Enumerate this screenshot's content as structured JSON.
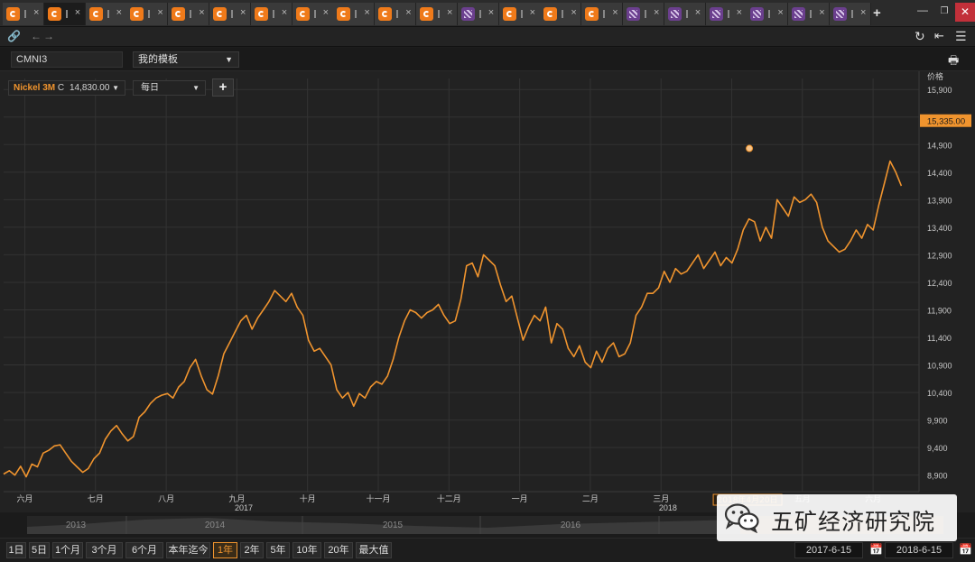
{
  "tabs": [
    {
      "icon": "orange-app-icon",
      "label": "c",
      "active": false
    },
    {
      "icon": "orange-app-icon",
      "label": "",
      "active": true
    },
    {
      "icon": "orange-app-icon",
      "label": "",
      "active": false
    },
    {
      "icon": "orange-app-icon",
      "label": "",
      "active": false
    },
    {
      "icon": "orange-app-icon",
      "label": "",
      "active": false
    },
    {
      "icon": "orange-app-icon",
      "label": "",
      "active": false
    },
    {
      "icon": "orange-app-icon",
      "label": "",
      "active": false
    },
    {
      "icon": "orange-app-icon",
      "label": "",
      "active": false
    },
    {
      "icon": "orange-app-icon",
      "label": "",
      "active": false
    },
    {
      "icon": "orange-app-icon",
      "label": "c",
      "active": false
    },
    {
      "icon": "orange-app-icon",
      "label": "",
      "active": false
    },
    {
      "icon": "purple-app-icon",
      "label": "",
      "active": false
    },
    {
      "icon": "orange-app-icon",
      "label": "",
      "active": false
    },
    {
      "icon": "orange-app-icon",
      "label": "",
      "active": false
    },
    {
      "icon": "orange-app-icon",
      "label": "",
      "active": false
    },
    {
      "icon": "purple-app-icon",
      "label": "",
      "active": false
    },
    {
      "icon": "purple-app-icon",
      "label": "",
      "active": false
    },
    {
      "icon": "purple-app-icon",
      "label": "",
      "active": false
    },
    {
      "icon": "purple-app-icon",
      "label": "",
      "active": false
    },
    {
      "icon": "purple-app-icon",
      "label": "",
      "active": false
    },
    {
      "icon": "purple-app-icon",
      "label": "",
      "active": false
    }
  ],
  "window": {
    "add_tab": "+",
    "minimize": "—",
    "maximize": "❐",
    "close": "✕"
  },
  "toolbar": {
    "ric": "CMNI3",
    "template": "我的模板",
    "series_name": "Nickel 3M",
    "series_price_type": "C",
    "series_value": "14,830.00",
    "interval": "每日",
    "add_label": "+"
  },
  "colors": {
    "line": "#f0942e",
    "grid": "#333333",
    "background": "#222222"
  },
  "chart_data": {
    "type": "line",
    "ylabel": "价格",
    "y_ticks": [
      8900,
      9400,
      9900,
      10400,
      10900,
      11400,
      11900,
      12400,
      12900,
      13400,
      13900,
      14400,
      14900,
      15400,
      15900
    ],
    "ylim": [
      8600,
      16100
    ],
    "last_value_label": "15,335.00",
    "last_value": 15335,
    "hover_label": "2018年4月20日",
    "hover_value": 14830,
    "x_labels": [
      "六月",
      "七月",
      "八月",
      "九月",
      "十月",
      "十一月",
      "十二月",
      "一月",
      "二月",
      "三月",
      "五月",
      "六月"
    ],
    "x_label_positions": [
      0.3,
      1.3,
      2.3,
      3.3,
      4.3,
      5.3,
      6.3,
      7.3,
      8.3,
      9.3,
      11.3,
      12.3
    ],
    "year_labels": [
      {
        "text": "2017",
        "at": 3.5
      },
      {
        "text": "2018",
        "at": 9.5
      }
    ],
    "x_range": [
      0,
      12.95
    ],
    "grid": true,
    "series": [
      {
        "points": [
          [
            0.0,
            8920
          ],
          [
            0.08,
            8980
          ],
          [
            0.15,
            8900
          ],
          [
            0.22,
            9060
          ],
          [
            0.3,
            8870
          ],
          [
            0.38,
            9100
          ],
          [
            0.46,
            9050
          ],
          [
            0.55,
            9300
          ],
          [
            0.63,
            9350
          ],
          [
            0.72,
            9430
          ],
          [
            0.8,
            9450
          ],
          [
            0.88,
            9300
          ],
          [
            0.96,
            9150
          ],
          [
            1.04,
            9050
          ],
          [
            1.12,
            8950
          ],
          [
            1.2,
            9020
          ],
          [
            1.28,
            9200
          ],
          [
            1.36,
            9300
          ],
          [
            1.44,
            9550
          ],
          [
            1.52,
            9700
          ],
          [
            1.6,
            9800
          ],
          [
            1.68,
            9650
          ],
          [
            1.76,
            9520
          ],
          [
            1.84,
            9600
          ],
          [
            1.92,
            9950
          ],
          [
            2.0,
            10050
          ],
          [
            2.1,
            10200
          ],
          [
            2.2,
            10300
          ],
          [
            2.3,
            10350
          ],
          [
            2.4,
            10380
          ],
          [
            2.5,
            10300
          ],
          [
            2.58,
            10500
          ],
          [
            2.66,
            10600
          ],
          [
            2.74,
            10850
          ],
          [
            2.82,
            11000
          ],
          [
            2.9,
            10700
          ],
          [
            2.97,
            10450
          ],
          [
            3.04,
            10370
          ],
          [
            3.12,
            10700
          ],
          [
            3.2,
            11100
          ],
          [
            3.28,
            11300
          ],
          [
            3.36,
            11500
          ],
          [
            3.44,
            11700
          ],
          [
            3.52,
            11800
          ],
          [
            3.6,
            11550
          ],
          [
            3.68,
            11750
          ],
          [
            3.76,
            11900
          ],
          [
            3.84,
            12050
          ],
          [
            3.92,
            12250
          ],
          [
            4.0,
            12150
          ],
          [
            4.08,
            12050
          ],
          [
            4.16,
            12200
          ],
          [
            4.24,
            11950
          ],
          [
            4.32,
            11800
          ],
          [
            4.4,
            11350
          ],
          [
            4.48,
            11150
          ],
          [
            4.56,
            11200
          ],
          [
            4.64,
            11050
          ],
          [
            4.72,
            10900
          ],
          [
            4.8,
            10450
          ],
          [
            4.88,
            10300
          ],
          [
            4.96,
            10400
          ],
          [
            5.03,
            10150
          ],
          [
            5.1,
            10380
          ],
          [
            5.18,
            10300
          ],
          [
            5.26,
            10500
          ],
          [
            5.34,
            10600
          ],
          [
            5.42,
            10550
          ],
          [
            5.5,
            10700
          ],
          [
            5.58,
            11000
          ],
          [
            5.66,
            11400
          ],
          [
            5.74,
            11700
          ],
          [
            5.82,
            11900
          ],
          [
            5.9,
            11850
          ],
          [
            5.98,
            11750
          ],
          [
            6.06,
            11850
          ],
          [
            6.14,
            11900
          ],
          [
            6.22,
            12000
          ],
          [
            6.3,
            11800
          ],
          [
            6.38,
            11650
          ],
          [
            6.46,
            11700
          ],
          [
            6.54,
            12100
          ],
          [
            6.62,
            12700
          ],
          [
            6.7,
            12750
          ],
          [
            6.78,
            12500
          ],
          [
            6.86,
            12900
          ],
          [
            6.94,
            12800
          ],
          [
            7.02,
            12700
          ],
          [
            7.1,
            12350
          ],
          [
            7.18,
            12050
          ],
          [
            7.26,
            12150
          ],
          [
            7.34,
            11750
          ],
          [
            7.42,
            11350
          ],
          [
            7.5,
            11600
          ],
          [
            7.58,
            11800
          ],
          [
            7.66,
            11700
          ],
          [
            7.74,
            11950
          ],
          [
            7.82,
            11300
          ],
          [
            7.9,
            11650
          ],
          [
            7.98,
            11550
          ],
          [
            8.06,
            11200
          ],
          [
            8.14,
            11050
          ],
          [
            8.22,
            11250
          ],
          [
            8.3,
            10950
          ],
          [
            8.38,
            10850
          ],
          [
            8.46,
            11150
          ],
          [
            8.54,
            10950
          ],
          [
            8.62,
            11200
          ],
          [
            8.7,
            11300
          ],
          [
            8.78,
            11050
          ],
          [
            8.86,
            11100
          ],
          [
            8.94,
            11300
          ],
          [
            9.02,
            11800
          ],
          [
            9.1,
            11950
          ],
          [
            9.18,
            12200
          ],
          [
            9.26,
            12200
          ],
          [
            9.34,
            12300
          ],
          [
            9.42,
            12600
          ],
          [
            9.5,
            12400
          ],
          [
            9.58,
            12650
          ],
          [
            9.66,
            12550
          ],
          [
            9.74,
            12600
          ],
          [
            9.82,
            12750
          ],
          [
            9.9,
            12900
          ],
          [
            9.98,
            12650
          ],
          [
            10.06,
            12800
          ]
        ]
      }
    ]
  },
  "navigator": {
    "years": [
      "2013",
      "2014",
      "2015",
      "2016"
    ]
  },
  "range_buttons": [
    "1日",
    "5日",
    "1个月",
    "3个月",
    "6个月",
    "本年迄今",
    "1年",
    "2年",
    "5年",
    "10年",
    "20年",
    "最大值"
  ],
  "active_range": "1年",
  "dates": {
    "from": "2017-6-15",
    "to": "2018-6-15"
  },
  "watermark": "五矿经济研究院"
}
